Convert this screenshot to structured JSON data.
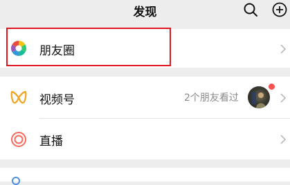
{
  "header": {
    "title": "发现",
    "search_icon": "search-icon",
    "add_icon": "add-circle-icon"
  },
  "items": {
    "moments": {
      "label": "朋友圈",
      "icon": "moments-aperture-icon"
    },
    "channels": {
      "label": "视频号",
      "icon": "channels-icon",
      "extra": "2个朋友看过",
      "badge": "red-dot"
    },
    "live": {
      "label": "直播",
      "icon": "live-icon"
    }
  },
  "colors": {
    "background": "#ededed",
    "highlight_border": "#e0141e",
    "channels_icon": "#f0a422",
    "live_icon": "#f56a5a",
    "badge": "#fa5151"
  }
}
